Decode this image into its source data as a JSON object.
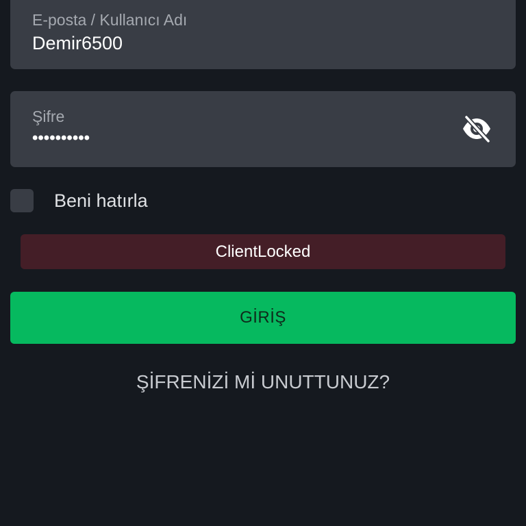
{
  "login_form": {
    "email_field": {
      "label": "E-posta / Kullanıcı Adı",
      "value": "Demir6500"
    },
    "password_field": {
      "label": "Şifre",
      "value": "••••••••••",
      "toggle_icon": "eye-slash-icon"
    },
    "remember_me": {
      "label": "Beni hatırla",
      "checked": false
    },
    "error_message": "ClientLocked",
    "login_button": "GİRİŞ",
    "forgot_password_link": "ŞİFRENİZİ Mİ UNUTTUNUZ?"
  },
  "colors": {
    "background": "#15191f",
    "field_background": "#393d45",
    "error_background": "#441e27",
    "primary_button": "#06b95f"
  }
}
